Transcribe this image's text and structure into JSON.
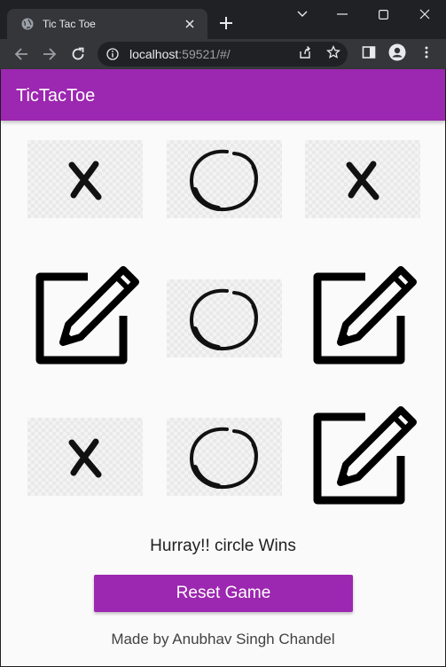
{
  "browser": {
    "tab_title": "Tic Tac Toe",
    "url_host": "localhost",
    "url_rest": ":59521/#/",
    "icons": [
      "globe-icon",
      "close-icon",
      "plus-icon",
      "chevron-down-icon",
      "minimize-icon",
      "maximize-icon",
      "back-icon",
      "forward-icon",
      "reload-icon",
      "info-icon",
      "share-icon",
      "star-icon",
      "sidepanel-icon",
      "profile-icon",
      "menu-icon"
    ]
  },
  "app": {
    "title": "TicTacToe",
    "accent": "#9c27b0",
    "board": [
      "x",
      "o",
      "x",
      "edit",
      "o",
      "edit",
      "x",
      "o",
      "edit"
    ],
    "status": "Hurray!! circle Wins",
    "reset_label": "Reset Game",
    "footer": "Made by Anubhav Singh Chandel"
  }
}
